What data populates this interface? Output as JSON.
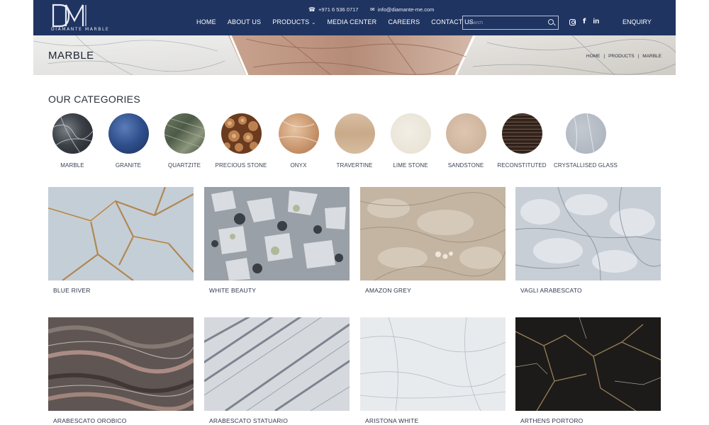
{
  "header": {
    "logo_text": "DM",
    "logo_subtext": "DIAMANTE MARBLE",
    "phone": "+971 6 536 0717",
    "email": "info@diamante-me.com",
    "nav": [
      {
        "label": "HOME"
      },
      {
        "label": "ABOUT US"
      },
      {
        "label": "PRODUCTS"
      },
      {
        "label": "MEDIA CENTER"
      },
      {
        "label": "CAREERS"
      },
      {
        "label": "CONTACT US"
      }
    ],
    "search_placeholder": "Search",
    "social_icons": [
      "instagram-icon",
      "facebook-icon",
      "linkedin-icon"
    ],
    "enquiry": "ENQUIRY",
    "colors": {
      "bar": "#1f3461",
      "text": "#ffffff"
    }
  },
  "banner": {
    "title": "MARBLE",
    "breadcrumb": [
      "HOME",
      "PRODUCTS",
      "MARBLE"
    ]
  },
  "categories": {
    "heading": "OUR CATEGORIES",
    "items": [
      {
        "label": "MARBLE"
      },
      {
        "label": "GRANITE"
      },
      {
        "label": "QUARTZITE"
      },
      {
        "label": "PRECIOUS STONE"
      },
      {
        "label": "ONYX"
      },
      {
        "label": "TRAVERTINE"
      },
      {
        "label": "LIME STONE"
      },
      {
        "label": "SANDSTONE"
      },
      {
        "label": "RECONSTITUTED"
      },
      {
        "label": "CRYSTALLISED GLASS"
      }
    ]
  },
  "products": [
    {
      "name": "BLUE RIVER"
    },
    {
      "name": "WHITE BEAUTY"
    },
    {
      "name": "AMAZON GREY"
    },
    {
      "name": "VAGLI ARABESCATO"
    },
    {
      "name": "ARABESCATO OROBICO"
    },
    {
      "name": "ARABESCATO STATUARIO"
    },
    {
      "name": "ARISTONA WHITE"
    },
    {
      "name": "ARTHENS PORTORO"
    }
  ]
}
